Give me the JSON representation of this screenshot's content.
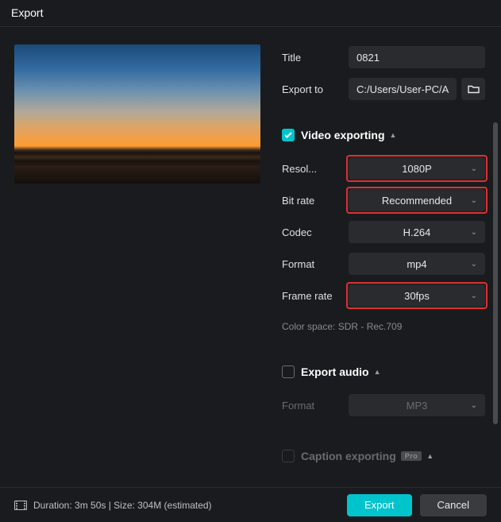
{
  "window": {
    "title": "Export"
  },
  "form": {
    "title_label": "Title",
    "title_value": "0821",
    "path_label": "Export to",
    "path_value": "C:/Users/User-PC/Ap..."
  },
  "video": {
    "section": "Video exporting",
    "resolution_label": "Resol...",
    "resolution_value": "1080P",
    "bitrate_label": "Bit rate",
    "bitrate_value": "Recommended",
    "codec_label": "Codec",
    "codec_value": "H.264",
    "format_label": "Format",
    "format_value": "mp4",
    "framerate_label": "Frame rate",
    "framerate_value": "30fps",
    "color_space": "Color space: SDR - Rec.709"
  },
  "audio": {
    "section": "Export audio",
    "format_label": "Format",
    "format_value": "MP3"
  },
  "caption": {
    "section": "Caption exporting",
    "badge": "Pro"
  },
  "footer": {
    "info": "Duration: 3m 50s | Size: 304M (estimated)",
    "export": "Export",
    "cancel": "Cancel"
  }
}
